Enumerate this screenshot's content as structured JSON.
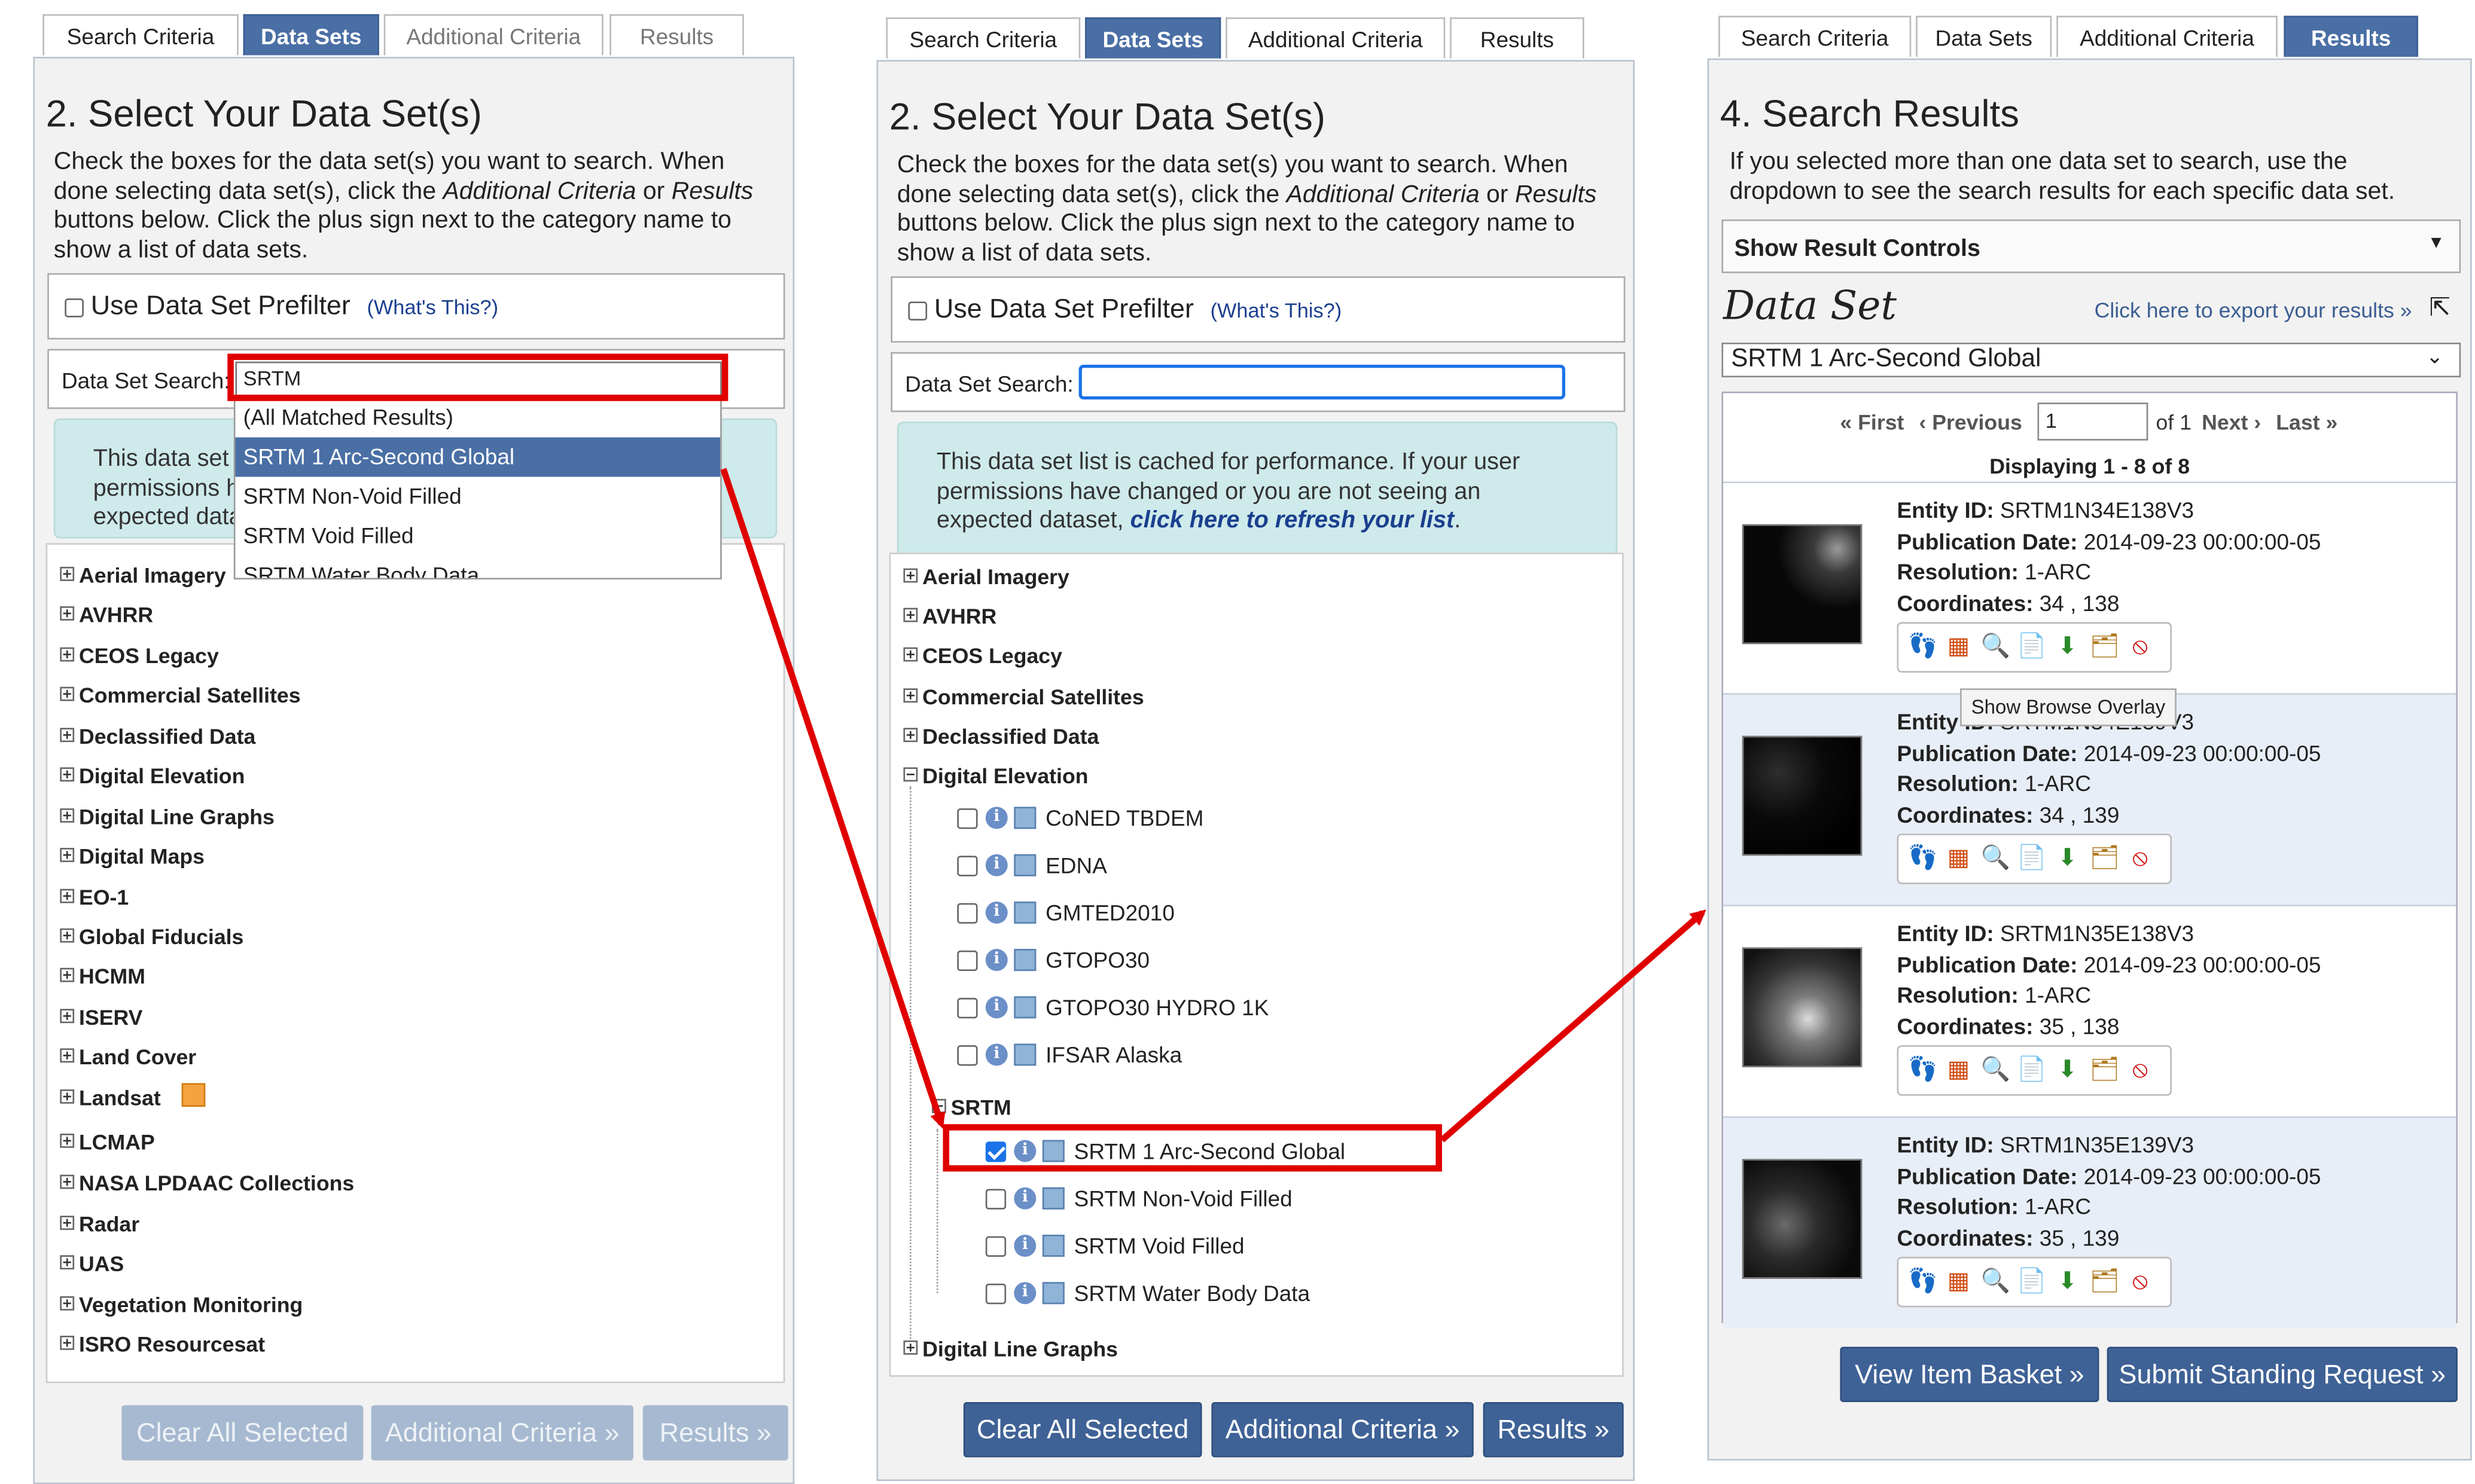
{
  "tabs": {
    "search_criteria": "Search Criteria",
    "data_sets": "Data Sets",
    "additional_criteria": "Additional Criteria",
    "results": "Results"
  },
  "left": {
    "title": "2. Select Your Data Set(s)",
    "desc": {
      "line1": "Check the boxes for the data set(s) you want to search. When",
      "line2a": "done selecting data set(s), click the ",
      "line2b": "Additional Criteria",
      "line2c": " or ",
      "line2d": "Results",
      "line3": "buttons below. Click the plus sign next to the category name to",
      "line4": "show a list of data sets."
    },
    "prefilter_label": "Use Data Set Prefilter",
    "whats_this": "(What's This?)",
    "search_label": "Data Set Search:",
    "search_value": "SRTM",
    "dropdown": [
      "(All Matched Results)",
      "SRTM 1 Arc-Second Global",
      "SRTM Non-Void Filled",
      "SRTM Void Filled",
      "SRTM Water Body Data"
    ],
    "info_partial": [
      "This data set",
      "permissions h",
      "expected data"
    ],
    "categories": [
      "Aerial Imagery",
      "AVHRR",
      "CEOS Legacy",
      "Commercial Satellites",
      "Declassified Data",
      "Digital Elevation",
      "Digital Line Graphs",
      "Digital Maps",
      "EO-1",
      "Global Fiducials",
      "HCMM",
      "ISERV",
      "Land Cover",
      "Landsat",
      "LCMAP",
      "NASA LPDAAC Collections",
      "Radar",
      "UAS",
      "Vegetation Monitoring",
      "ISRO Resourcesat"
    ],
    "buttons": {
      "clear": "Clear All Selected",
      "additional": "Additional Criteria »",
      "results": "Results »"
    }
  },
  "middle": {
    "info": {
      "line1": "This data set list is cached for performance. If your user",
      "line2": "permissions have changed or you are not seeing an",
      "line3a": "expected dataset, ",
      "line3b": "click here to refresh your list",
      "line3c": "."
    },
    "categories_top": [
      "Aerial Imagery",
      "AVHRR",
      "CEOS Legacy",
      "Commercial Satellites",
      "Declassified Data",
      "Digital Elevation"
    ],
    "elevation_sets": [
      "CoNED TBDEM",
      "EDNA",
      "GMTED2010",
      "GTOPO30",
      "GTOPO30 HYDRO 1K",
      "IFSAR Alaska"
    ],
    "srtm_label": "SRTM",
    "srtm_sets": [
      "SRTM 1 Arc-Second Global",
      "SRTM Non-Void Filled",
      "SRTM Void Filled",
      "SRTM Water Body Data"
    ],
    "last_category": "Digital Line Graphs"
  },
  "right": {
    "title": "4. Search Results",
    "desc1": "If you selected more than one data set to search, use the",
    "desc2": "dropdown to see the search results for each specific data set.",
    "controls": "Show Result Controls",
    "dataset_heading": "Data Set",
    "export": "Click here to export your results »",
    "dataset_value": "SRTM 1 Arc-Second Global",
    "pager": {
      "first": "« First",
      "previous": "‹ Previous",
      "page": "1",
      "of": "of 1",
      "next": "Next ›",
      "last": "Last »"
    },
    "displaying": "Displaying 1 - 8 of 8",
    "labels": {
      "entity": "Entity ID:",
      "pub": "Publication Date:",
      "res": "Resolution:",
      "coords": "Coordinates:"
    },
    "tooltip": "Show Browse Overlay",
    "results": [
      {
        "entity": "SRTM1N34E138V3",
        "pub": "2014-09-23 00:00:00-05",
        "res": "1-ARC",
        "coords": "34 , 138"
      },
      {
        "entity": "SRTM1N34E139V3",
        "pub": "2014-09-23 00:00:00-05",
        "res": "1-ARC",
        "coords": "34 , 139"
      },
      {
        "entity": "SRTM1N35E138V3",
        "pub": "2014-09-23 00:00:00-05",
        "res": "1-ARC",
        "coords": "35 , 138"
      },
      {
        "entity": "SRTM1N35E139V3",
        "pub": "2014-09-23 00:00:00-05",
        "res": "1-ARC",
        "coords": "35 , 139"
      }
    ],
    "row2_entity_prefix": "Entity ID:",
    "buttons": {
      "basket": "View Item Basket »",
      "standing": "Submit Standing Request »"
    }
  },
  "colors": {
    "accent": "#4a6fa5",
    "highlight": "#e00000",
    "info_bg": "#cfeaea"
  }
}
